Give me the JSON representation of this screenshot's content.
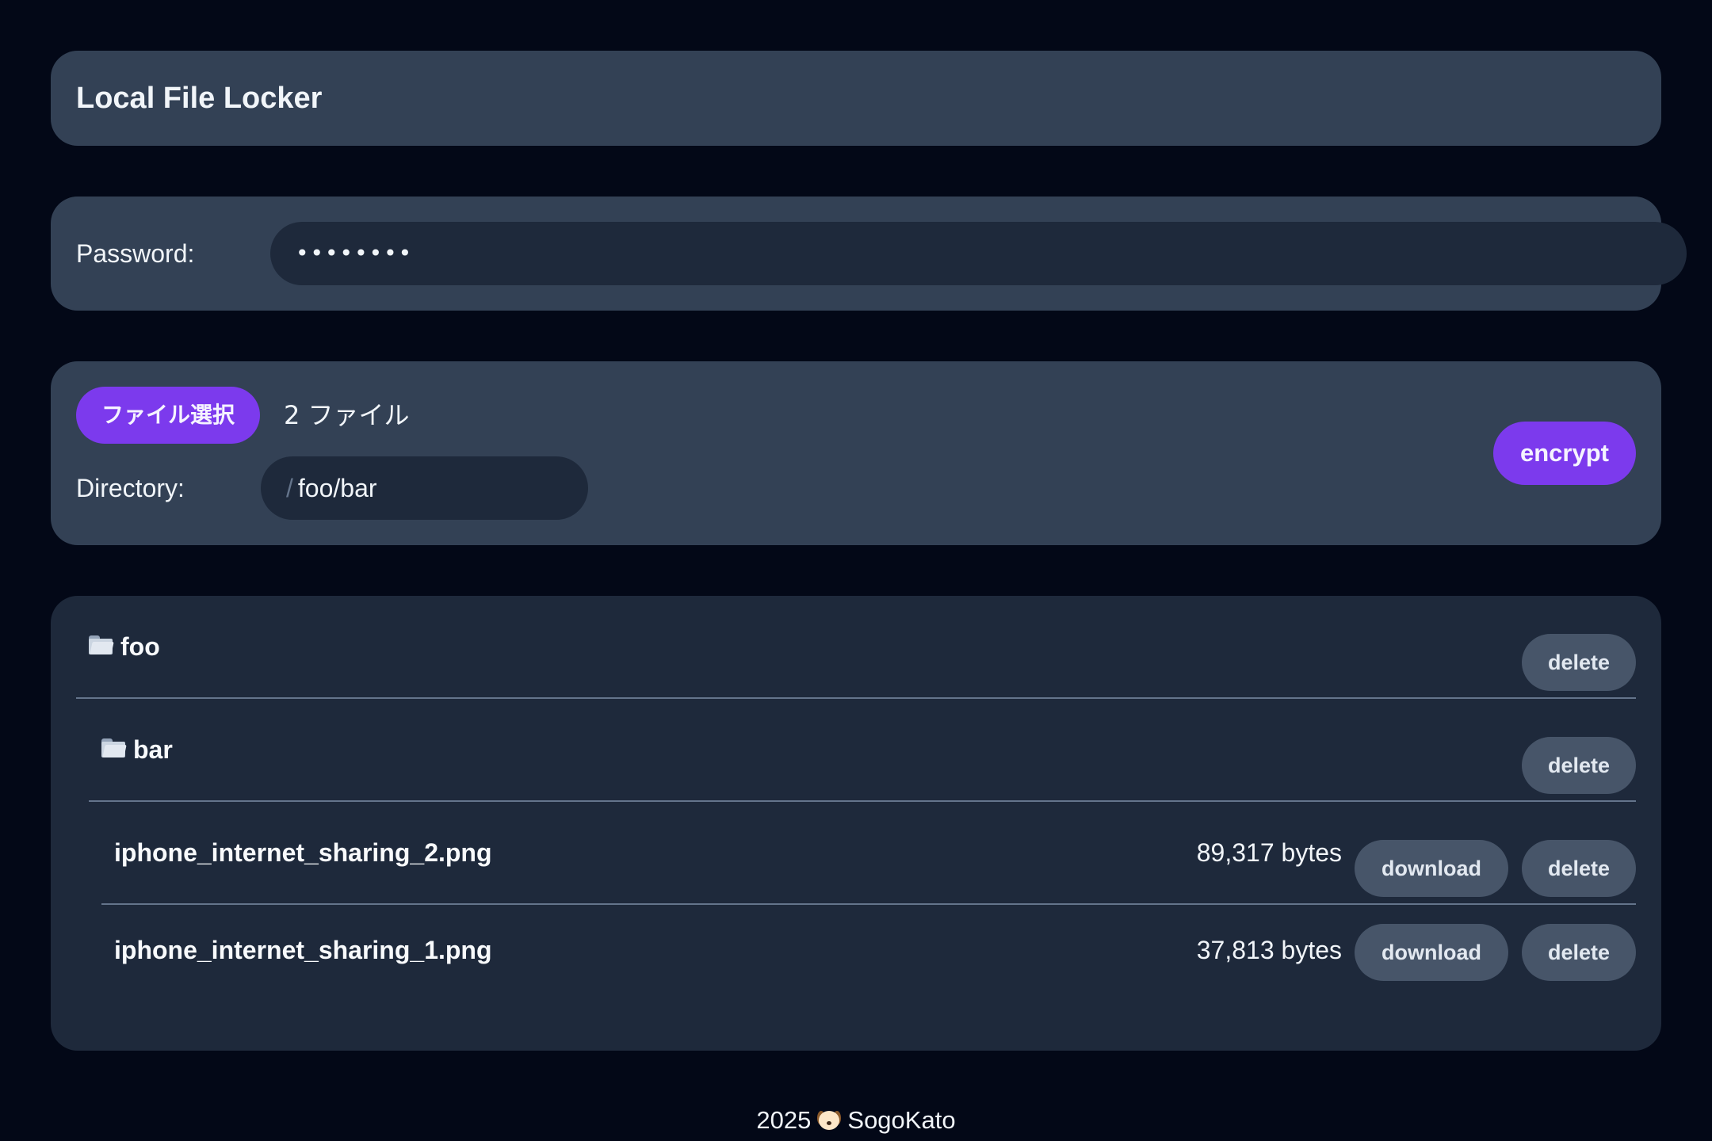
{
  "header": {
    "title": "Local File Locker"
  },
  "password": {
    "label": "Password:",
    "masked_value": "••••••••"
  },
  "upload": {
    "choose_button": "ファイル選択",
    "file_count": "2 ファイル",
    "directory_label": "Directory:",
    "directory_prefix": "/",
    "directory_value": "foo/bar",
    "encrypt_button": "encrypt"
  },
  "tree": {
    "folders": [
      {
        "name": "foo",
        "icon": "folder-icon",
        "delete_label": "delete"
      },
      {
        "name": "bar",
        "icon": "folder-icon",
        "delete_label": "delete"
      }
    ],
    "files": [
      {
        "name": "iphone_internet_sharing_2.png",
        "size": "89,317 bytes",
        "download_label": "download",
        "delete_label": "delete"
      },
      {
        "name": "iphone_internet_sharing_1.png",
        "size": "37,813 bytes",
        "download_label": "download",
        "delete_label": "delete"
      }
    ]
  },
  "footer": {
    "year": "2025",
    "icon": "dog-icon",
    "author": "SogoKato"
  },
  "colors": {
    "background": "#030817",
    "card": "#334155",
    "list_card": "#1e293b",
    "accent": "#7c3aed",
    "secondary_button": "#475569"
  }
}
